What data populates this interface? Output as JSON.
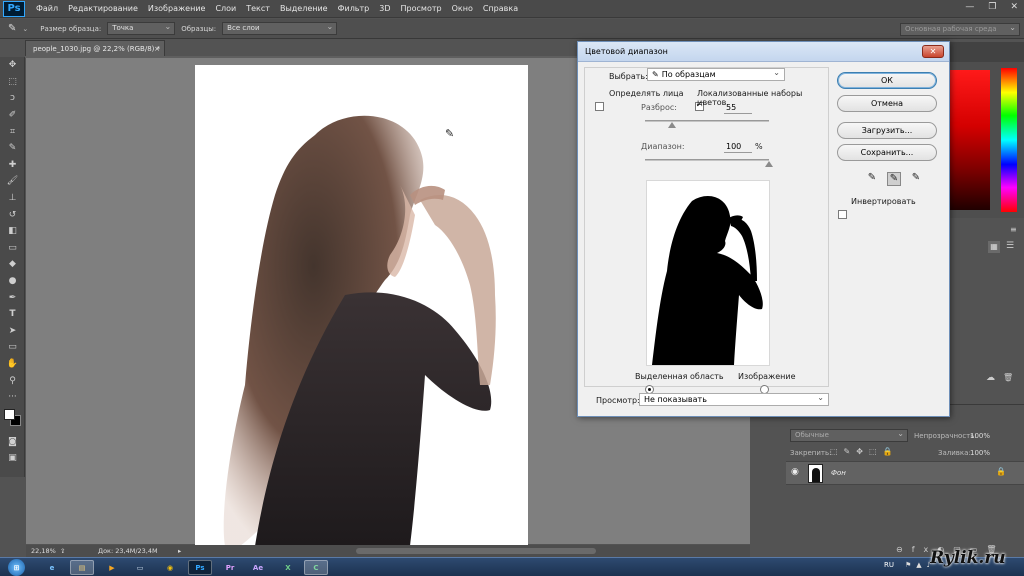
{
  "app": {
    "logo": "Ps",
    "menu": [
      "Файл",
      "Редактирование",
      "Изображение",
      "Слои",
      "Текст",
      "Выделение",
      "Фильтр",
      "3D",
      "Просмотр",
      "Окно",
      "Справка"
    ]
  },
  "options_bar": {
    "sample_size_label": "Размер образца:",
    "sample_size_value": "Точка",
    "samples_label": "Образцы:",
    "samples_value": "Все слои",
    "workspace_value": "Основная рабочая среда"
  },
  "document": {
    "tab_title": "people_1030.jpg @ 22,2% (RGB/8) *",
    "zoom": "22,18%",
    "doc_info": "Док: 23,4M/23,4M"
  },
  "dialog": {
    "title": "Цветовой диапазон",
    "select_label": "Выбрать:",
    "select_value": "По образцам",
    "detect_faces_label": "Определять лица",
    "localized_label": "Локализованные наборы цветов",
    "fuzziness_label": "Разброс:",
    "fuzziness_value": "55",
    "fuzziness_fraction": 0.22,
    "range_label": "Диапазон:",
    "range_value": "100",
    "range_unit": "%",
    "range_fraction": 1.0,
    "radio_selection_label": "Выделенная область",
    "radio_image_label": "Изображение",
    "preview_label": "Просмотр:",
    "preview_value": "Не показывать",
    "ok_label": "ОК",
    "cancel_label": "Отмена",
    "load_label": "Загрузить...",
    "save_label": "Сохранить...",
    "invert_label": "Инвертировать"
  },
  "layers": {
    "blend_mode": "Обычные",
    "opacity_label": "Непрозрачность:",
    "opacity_value": "100%",
    "lock_label": "Закрепить:",
    "fill_label": "Заливка:",
    "fill_value": "100%",
    "layer_name": "Фон"
  },
  "taskbar": {
    "language": "RU"
  },
  "watermark": "Rylik.ru",
  "colors": {
    "ps_blue": "#31a8ff",
    "dialog_bg": "#f0f0f0",
    "canvas_bg": "#7f7f7f"
  }
}
